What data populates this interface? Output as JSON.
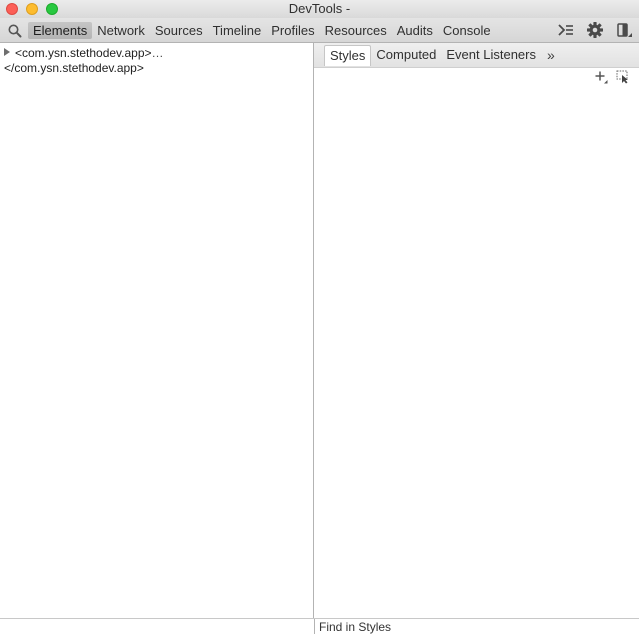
{
  "window": {
    "title": "DevTools -"
  },
  "toolbar": {
    "tabs": [
      {
        "label": "Elements",
        "active": true
      },
      {
        "label": "Network"
      },
      {
        "label": "Sources"
      },
      {
        "label": "Timeline"
      },
      {
        "label": "Profiles"
      },
      {
        "label": "Resources"
      },
      {
        "label": "Audits"
      },
      {
        "label": "Console"
      }
    ],
    "icons": [
      "search-icon",
      "console-drawer-icon",
      "gear-icon",
      "dock-icon"
    ]
  },
  "elements": {
    "open_tag": "<com.ysn.stethodev.app>",
    "ellipsis": "…",
    "close_tag": "</com.ysn.stethodev.app>"
  },
  "sidebar": {
    "tabs": [
      {
        "label": "Styles",
        "active": true
      },
      {
        "label": "Computed"
      },
      {
        "label": "Event Listeners"
      }
    ],
    "more_label": "»",
    "icons": [
      "add-rule-icon",
      "element-state-icon"
    ]
  },
  "footer": {
    "find_placeholder": "Find in Styles"
  },
  "colors": {
    "close": "#fc5f57",
    "minimize": "#fdbc2e",
    "zoom": "#28c840"
  }
}
